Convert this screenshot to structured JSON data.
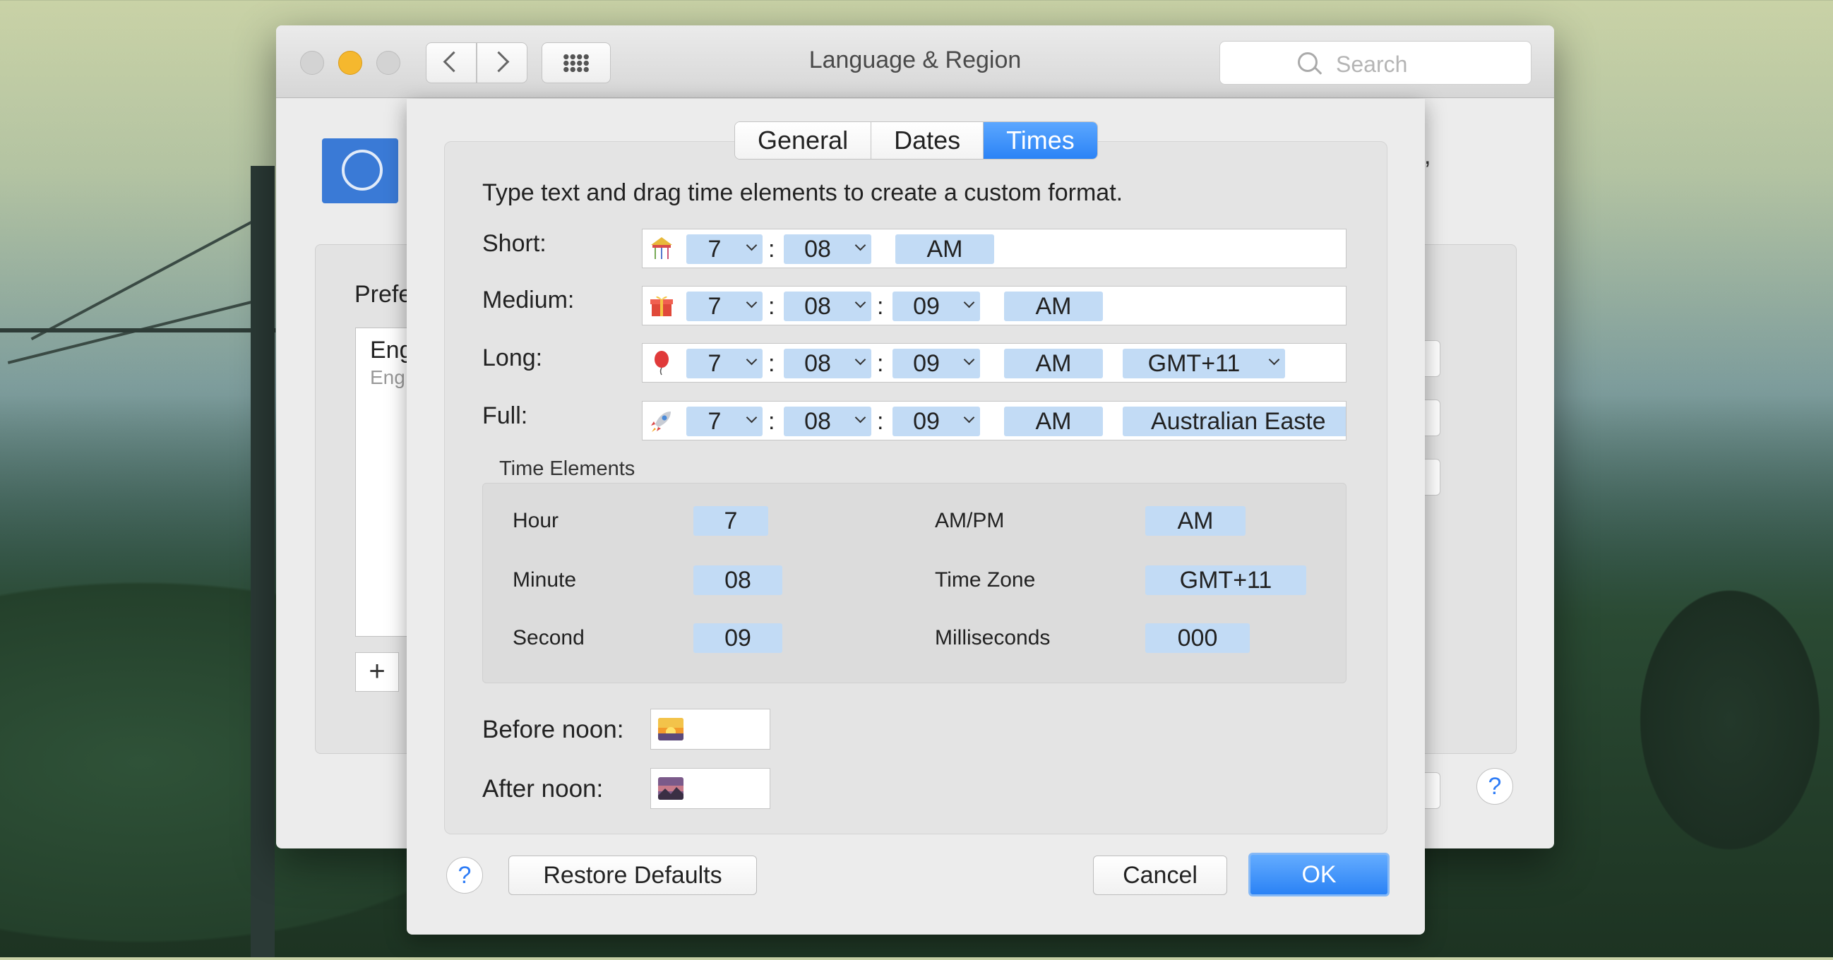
{
  "window": {
    "title": "Language & Region",
    "search_placeholder": "Search",
    "preferred_label": "Prefe",
    "lang_primary": "Eng",
    "lang_secondary": "Eng",
    "add_label": "+",
    "help_label": "?",
    "comma": ","
  },
  "sheet": {
    "tabs": [
      {
        "label": "General",
        "active": false
      },
      {
        "label": "Dates",
        "active": false
      },
      {
        "label": "Times",
        "active": true
      }
    ],
    "instruction": "Type text and drag time elements to create a custom format.",
    "formats": [
      {
        "label": "Short:",
        "emoji_icon": "carousel-icon",
        "hour": "7",
        "minute": "08",
        "ampm": "AM"
      },
      {
        "label": "Medium:",
        "emoji_icon": "gift-icon",
        "hour": "7",
        "minute": "08",
        "second": "09",
        "ampm": "AM"
      },
      {
        "label": "Long:",
        "emoji_icon": "balloon-icon",
        "hour": "7",
        "minute": "08",
        "second": "09",
        "ampm": "AM",
        "zone": "GMT+11"
      },
      {
        "label": "Full:",
        "emoji_icon": "rocket-icon",
        "hour": "7",
        "minute": "08",
        "second": "09",
        "ampm": "AM",
        "zone": "Australian Easte"
      }
    ],
    "separator": ":",
    "time_elements": {
      "title": "Time Elements",
      "items": [
        {
          "label": "Hour",
          "value": "7"
        },
        {
          "label": "Minute",
          "value": "08"
        },
        {
          "label": "Second",
          "value": "09"
        },
        {
          "label": "AM/PM",
          "value": "AM"
        },
        {
          "label": "Time Zone",
          "value": "GMT+11"
        },
        {
          "label": "Milliseconds",
          "value": "000"
        }
      ]
    },
    "before_noon_label": "Before noon:",
    "after_noon_label": "After noon:",
    "before_noon_icon": "sunrise-icon",
    "after_noon_icon": "sunset-icon",
    "help_label": "?",
    "restore_label": "Restore Defaults",
    "cancel_label": "Cancel",
    "ok_label": "OK"
  },
  "colors": {
    "accent": "#2b83f6",
    "token": "#c2dbf5",
    "minimize": "#f5b82e"
  }
}
